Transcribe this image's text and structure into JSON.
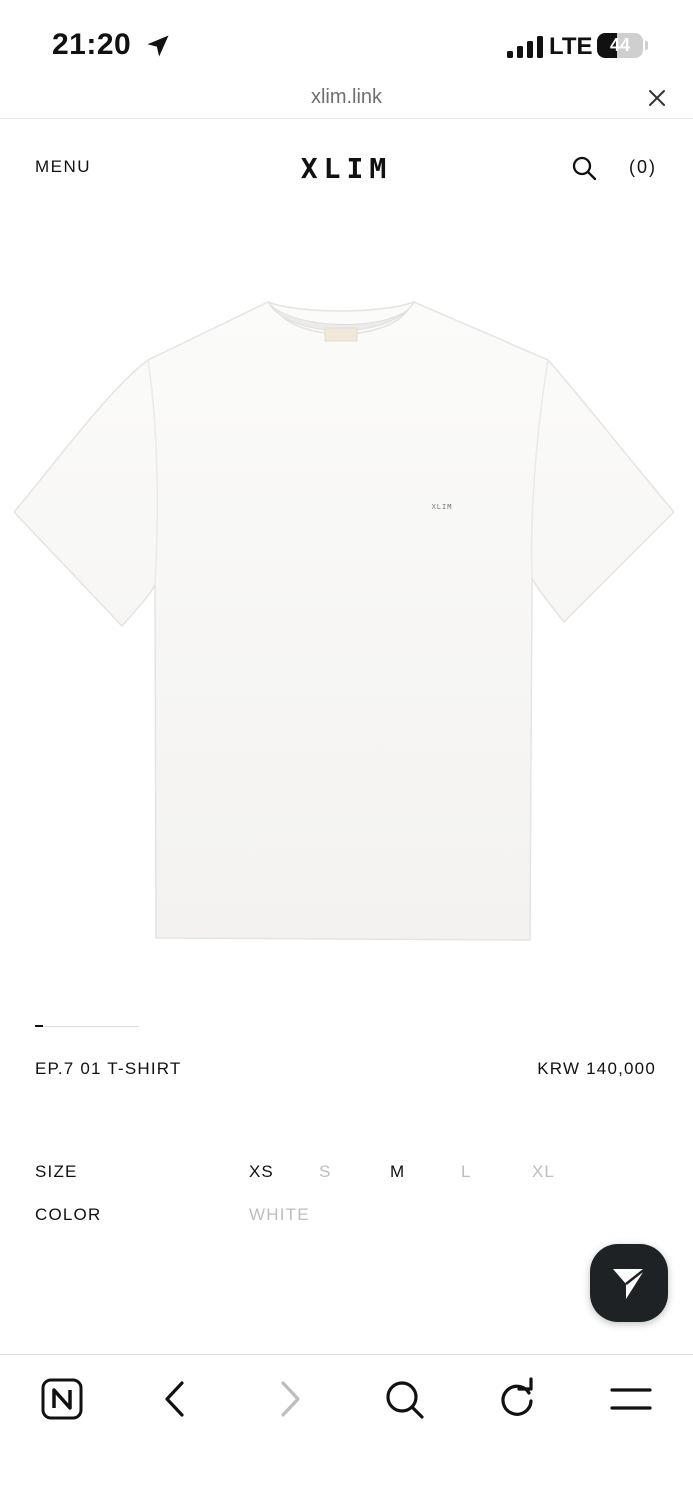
{
  "status_bar": {
    "time": "21:20",
    "network": "LTE",
    "battery_level": "44",
    "battery_fraction": 0.44
  },
  "browser": {
    "url": "xlim.link"
  },
  "header": {
    "menu_label": "MENU",
    "brand": "XLIM",
    "cart_count": "(0)"
  },
  "product": {
    "image_chest_print": "XLIM",
    "name": "EP.7 01 T-SHIRT",
    "price": "KRW 140,000",
    "size_label": "SIZE",
    "sizes": [
      {
        "label": "XS",
        "available": true
      },
      {
        "label": "S",
        "available": false
      },
      {
        "label": "M",
        "available": true
      },
      {
        "label": "L",
        "available": false
      },
      {
        "label": "XL",
        "available": false
      }
    ],
    "color_label": "COLOR",
    "color_value": "WHITE",
    "image_index": 1
  },
  "icons": {
    "status": [
      "location-arrow-icon",
      "signal-icon",
      "battery-icon"
    ],
    "toolbar": [
      "naver-home-icon",
      "back-arrow-icon",
      "forward-arrow-icon",
      "search-icon",
      "refresh-icon",
      "hamburger-menu-icon"
    ],
    "floating": "send-plane-icon"
  },
  "colors": {
    "text": "#111111",
    "muted": "#bdbdbd",
    "floating_button": "#1f2224"
  }
}
